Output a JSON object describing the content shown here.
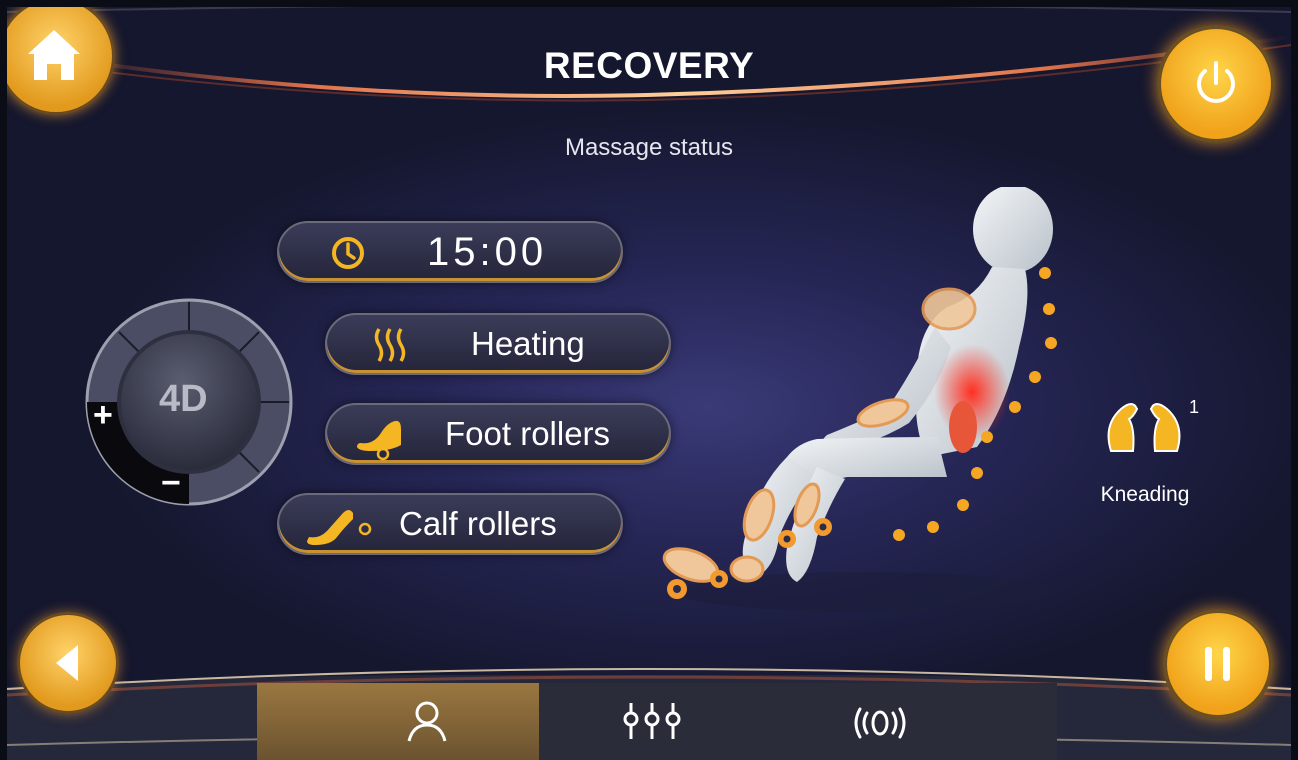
{
  "header": {
    "title": "RECOVERY",
    "subtitle": "Massage status"
  },
  "status": {
    "timer": "15:00",
    "heating_label": "Heating",
    "foot_rollers_label": "Foot rollers",
    "calf_rollers_label": "Calf rollers"
  },
  "dial": {
    "label": "4D",
    "plus": "+",
    "minus": "−"
  },
  "technique": {
    "label": "Kneading",
    "level": "1"
  },
  "tabs": [
    {
      "icon": "person-icon",
      "active": true
    },
    {
      "icon": "sliders-icon",
      "active": false
    },
    {
      "icon": "vibration-icon",
      "active": false
    }
  ],
  "colors": {
    "accent": "#f5b623",
    "gold": "#c89232",
    "background": "#262656"
  },
  "icons": {
    "home": "home-icon",
    "power": "power-icon",
    "back": "back-arrow-icon",
    "pause": "pause-icon",
    "clock": "clock-icon",
    "heat": "heat-waves-icon",
    "foot": "foot-roller-icon",
    "calf": "calf-roller-icon",
    "kneading": "kneading-hands-icon"
  }
}
